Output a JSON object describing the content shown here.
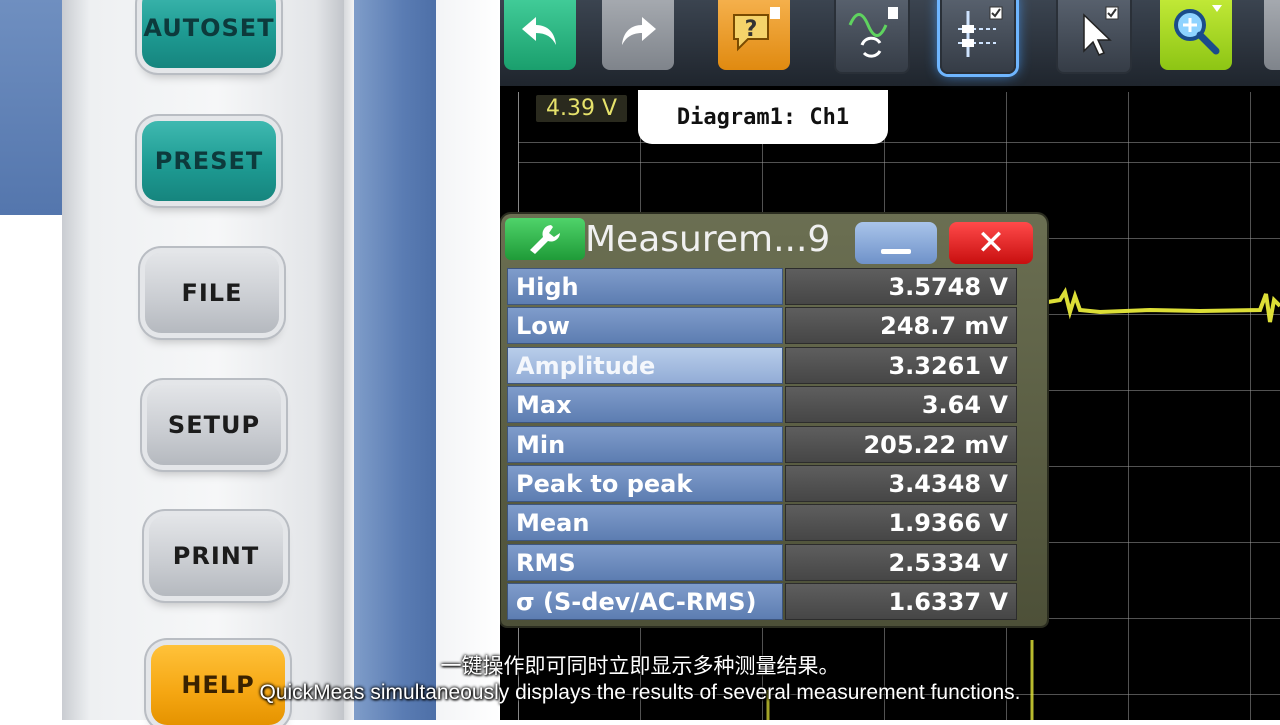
{
  "hardware_buttons": {
    "autoset": "AUTOSET",
    "preset": "PRESET",
    "file": "FILE",
    "setup": "SETUP",
    "print": "PRINT",
    "help": "HELP"
  },
  "toolbar": {
    "icons": [
      "undo-icon",
      "redo-icon",
      "help-icon",
      "signal-refresh-icon",
      "layout-icon",
      "pointer-icon",
      "zoom-icon"
    ]
  },
  "screen": {
    "trigger_level": "4.39 V",
    "diagram_tab": "Diagram1: Ch1"
  },
  "measurement": {
    "title": "Measurem...9",
    "minimize_label": "_",
    "close_label": "✕",
    "rows": [
      {
        "label": "High",
        "value": "3.5748 V"
      },
      {
        "label": "Low",
        "value": "248.7 mV"
      },
      {
        "label": "Amplitude",
        "value": "3.3261 V"
      },
      {
        "label": "Max",
        "value": "3.64 V"
      },
      {
        "label": "Min",
        "value": "205.22 mV"
      },
      {
        "label": "Peak to peak",
        "value": "3.4348 V"
      },
      {
        "label": "Mean",
        "value": "1.9366 V"
      },
      {
        "label": "RMS",
        "value": "2.5334 V"
      },
      {
        "label": "σ (S-dev/AC-RMS)",
        "value": "1.6337 V"
      }
    ]
  },
  "subtitles": {
    "chinese": "一键操作即可同时立即显示多种测量结果。",
    "english": "QuickMeas simultaneously displays the results of several measurement functions."
  },
  "colors": {
    "trace": "#e8ea3a",
    "accent_teal": "#1e9b93",
    "accent_orange": "#f5a612"
  }
}
